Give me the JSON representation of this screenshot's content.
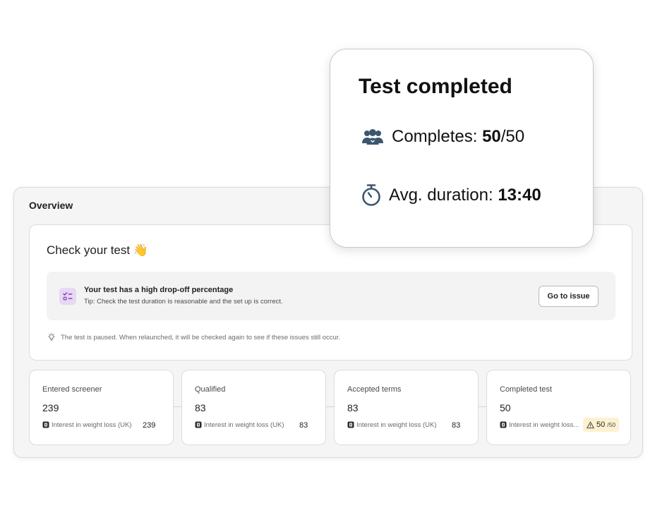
{
  "overview": {
    "title": "Overview",
    "check": {
      "title": "Check your test 👋",
      "issue": {
        "icon": "checklist-icon",
        "title": "Your test has a high drop-off percentage",
        "tip": "Tip: Check the test duration is reasonable and the set up is correct.",
        "button_label": "Go to issue"
      },
      "paused_icon": "lightbulb-icon",
      "paused_text": "The test is paused. When relaunched, it will be checked again to see if these issues still occur."
    },
    "stats": [
      {
        "label": "Entered screener",
        "value": "239",
        "segment": "Interest in weight loss (UK)",
        "count": "239"
      },
      {
        "label": "Qualified",
        "value": "83",
        "segment": "Interest in weight loss (UK)",
        "count": "83"
      },
      {
        "label": "Accepted terms",
        "value": "83",
        "segment": "Interest in weight loss (UK)",
        "count": "83"
      },
      {
        "label": "Completed test",
        "value": "50",
        "segment": "Interest in weight loss...",
        "warn_count": "50",
        "warn_total": "/50"
      }
    ]
  },
  "popup": {
    "title": "Test completed",
    "completes_label": "Completes: ",
    "completes_value": "50",
    "completes_total": "/50",
    "duration_label": "Avg. duration: ",
    "duration_value": "13:40"
  },
  "colors": {
    "icon_slate": "#3d5670",
    "issue_icon_bg": "#e7d8f4",
    "issue_icon_fg": "#8a4fc2",
    "warn_bg": "#fdf1d0"
  }
}
